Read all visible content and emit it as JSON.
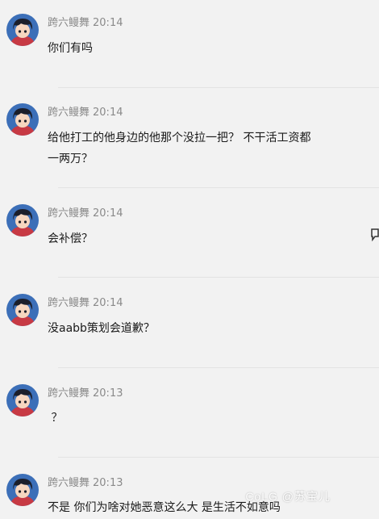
{
  "messages": [
    {
      "user": "跨六鳗舞",
      "time": "20:14",
      "text": "你们有吗"
    },
    {
      "user": "跨六鳗舞",
      "time": "20:14",
      "text": "给他打工的他身边的他那个没拉一把？  不干活工资都一两万？"
    },
    {
      "user": "跨六鳗舞",
      "time": "20:14",
      "text": "会补偿？"
    },
    {
      "user": "跨六鳗舞",
      "time": "20:14",
      "text": "没aabb策划会道歉？"
    },
    {
      "user": "跨六鳗舞",
      "time": "20:13",
      "text": " ？"
    },
    {
      "user": "跨六鳗舞",
      "time": "20:13",
      "text": "不是 你们为啥对她恶意这么大 是生活不如意吗"
    }
  ],
  "watermark": "CoLG @苏宝儿",
  "icons": {
    "avatar": "anime-character-avatar",
    "side": "reply-icon"
  }
}
